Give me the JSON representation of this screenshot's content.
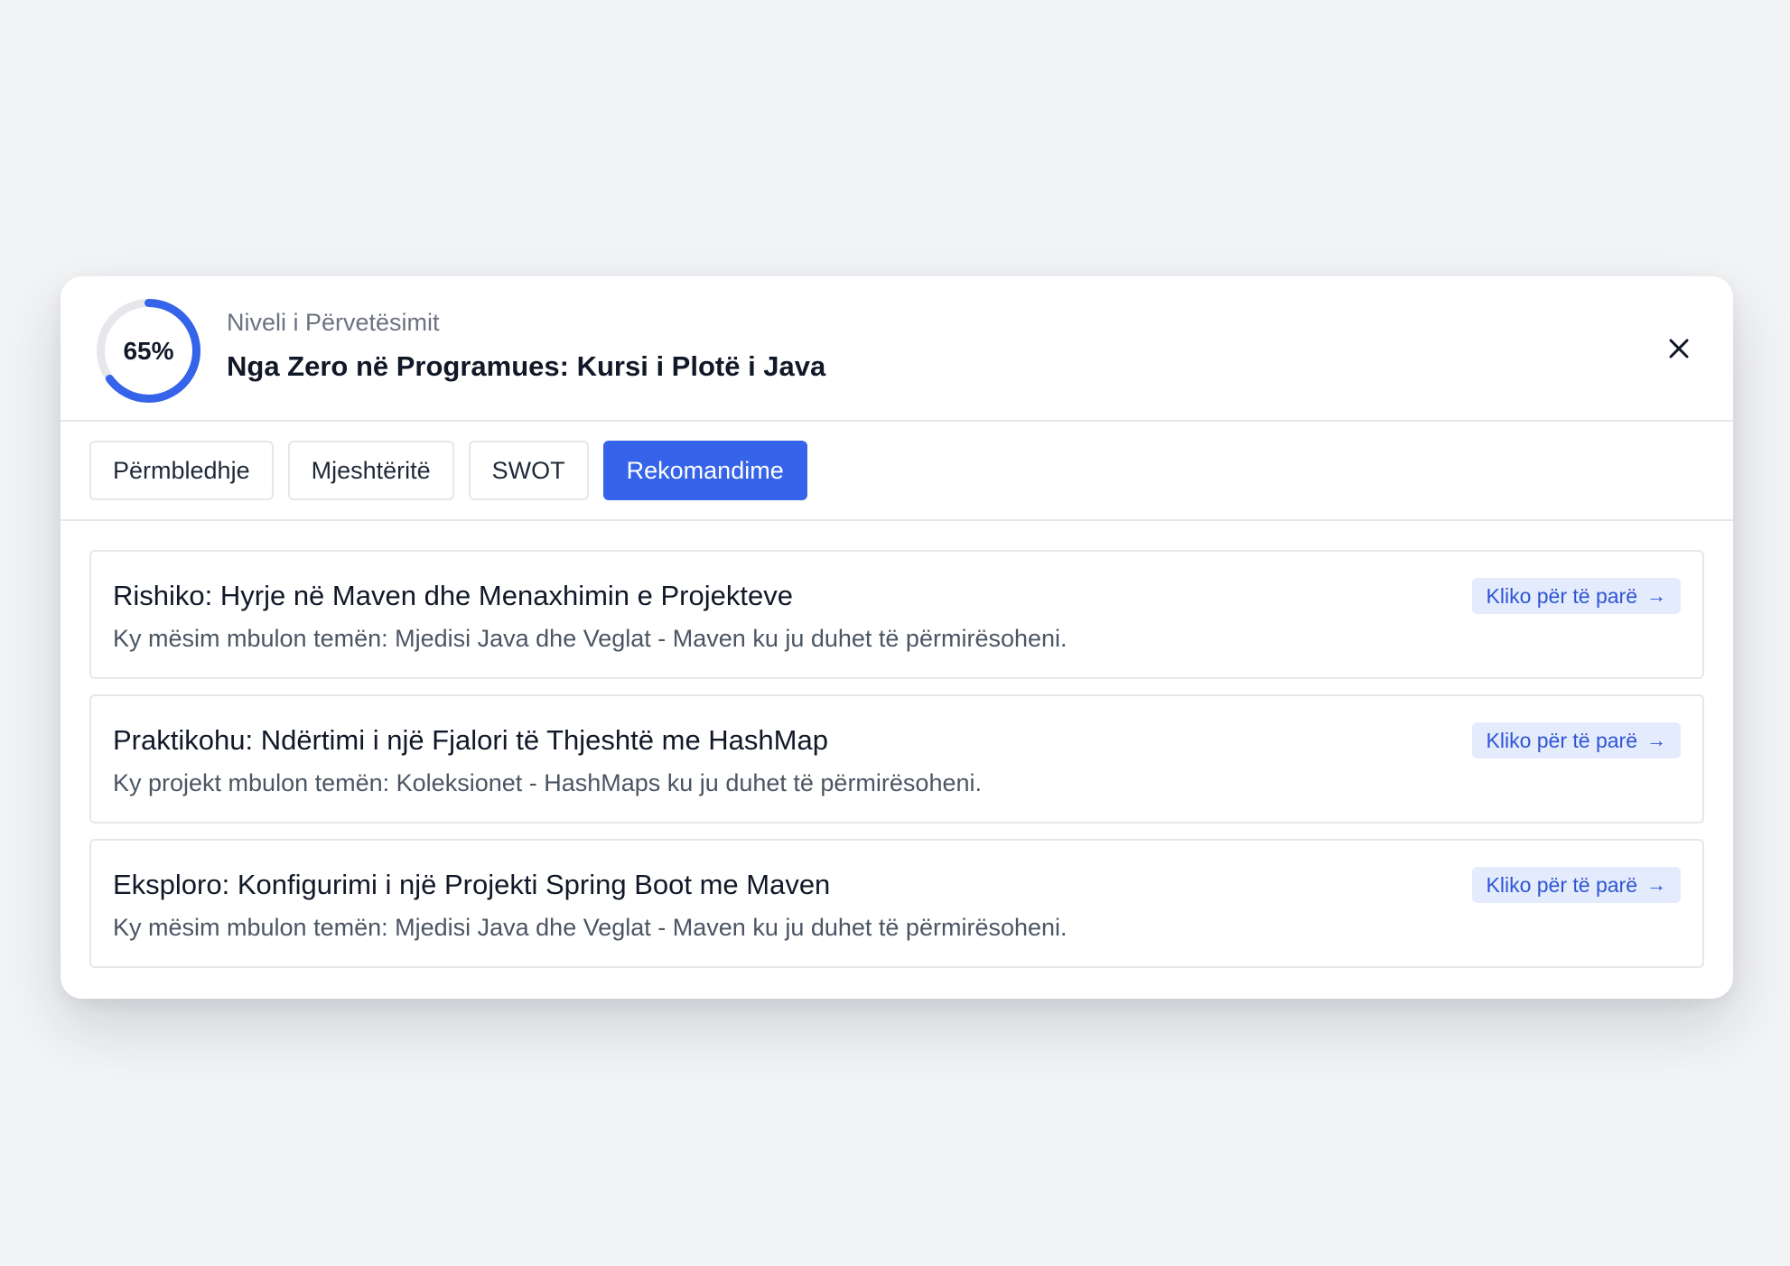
{
  "modal": {
    "progress": {
      "percent": 65,
      "label": "65%",
      "track_color": "#e5e7eb",
      "fill_color": "#3563e9"
    },
    "subtitle": "Niveli i Përvetësimit",
    "title": "Nga Zero në Programues: Kursi i Plotë i Java",
    "close_icon": "close-icon"
  },
  "tabs": [
    {
      "label": "Përmbledhje",
      "active": false
    },
    {
      "label": "Mjeshtëritë",
      "active": false
    },
    {
      "label": "SWOT",
      "active": false
    },
    {
      "label": "Rekomandime",
      "active": true
    }
  ],
  "recommendations": [
    {
      "title": "Rishiko: Hyrje në Maven dhe Menaxhimin e Projekteve",
      "description": "Ky mësim mbulon temën: Mjedisi Java dhe Veglat - Maven ku ju duhet të përmirësoheni.",
      "link_label": "Kliko për të parë",
      "link_icon": "→"
    },
    {
      "title": "Praktikohu: Ndërtimi i një Fjalori të Thjeshtë me HashMap",
      "description": "Ky projekt mbulon temën: Koleksionet - HashMaps ku ju duhet të përmirësoheni.",
      "link_label": "Kliko për të parë",
      "link_icon": "→"
    },
    {
      "title": "Eksploro: Konfigurimi i një Projekti Spring Boot me Maven",
      "description": "Ky mësim mbulon temën: Mjedisi Java dhe Veglat - Maven ku ju duhet të përmirësoheni.",
      "link_label": "Kliko për të parë",
      "link_icon": "→"
    }
  ]
}
